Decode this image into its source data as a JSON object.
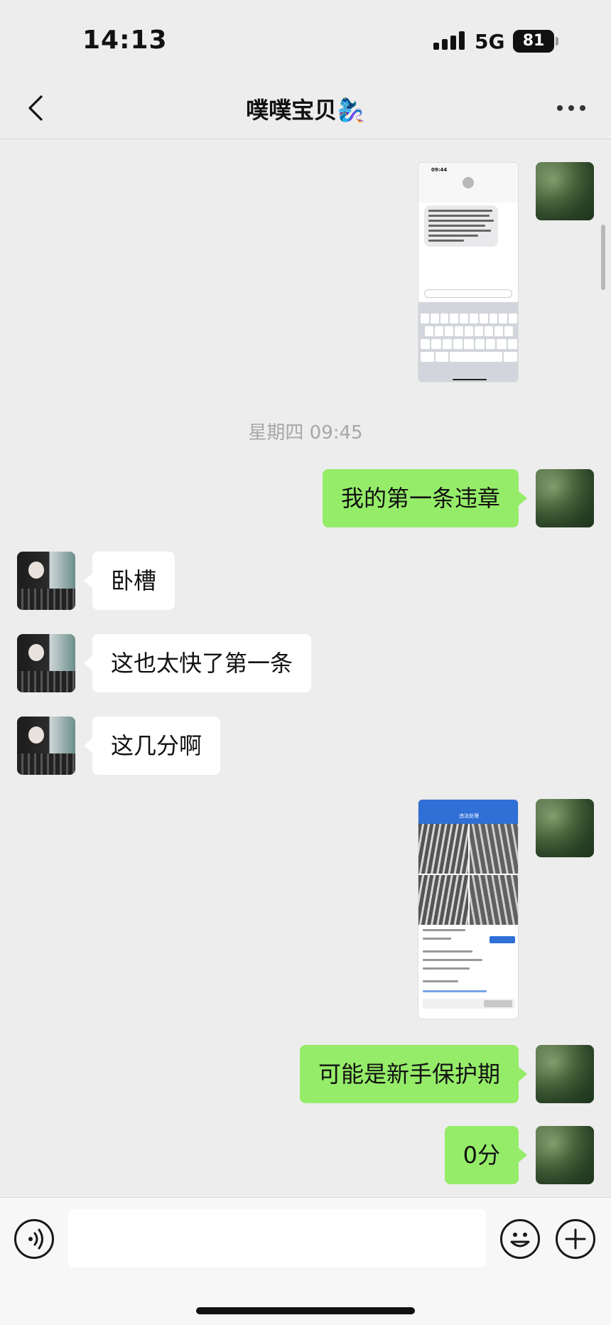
{
  "status_bar": {
    "time": "14:13",
    "network": "5G",
    "battery": "81"
  },
  "nav": {
    "title": "噗噗宝贝🧞‍♀️"
  },
  "timestamp": "星期四 09:45",
  "messages": [
    {
      "from": "self",
      "type": "image",
      "content": "SMS screenshot"
    },
    {
      "from": "self",
      "type": "text",
      "text": "我的第一条违章"
    },
    {
      "from": "other",
      "type": "text",
      "text": "卧槽"
    },
    {
      "from": "other",
      "type": "text",
      "text": "这也太快了第一条"
    },
    {
      "from": "other",
      "type": "text",
      "text": "这几分啊"
    },
    {
      "from": "self",
      "type": "image",
      "content": "违法处理 screenshot"
    },
    {
      "from": "self",
      "type": "text",
      "text": "可能是新手保护期"
    },
    {
      "from": "self",
      "type": "text",
      "text": "0分"
    }
  ],
  "thumbnails": {
    "sms_time": "09:44",
    "violation_title": "违法处理"
  },
  "input": {
    "placeholder": ""
  },
  "icons": [
    "back-icon",
    "more-icon",
    "voice-icon",
    "emoji-icon",
    "plus-icon"
  ]
}
